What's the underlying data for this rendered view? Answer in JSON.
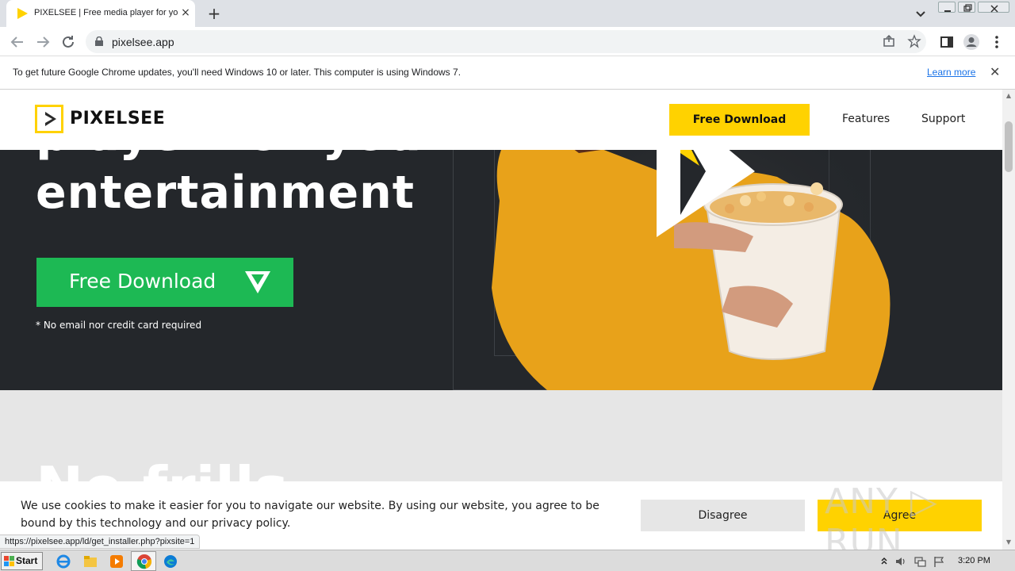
{
  "browser": {
    "tab_title": "PIXELSEE | Free media player for your entertainment",
    "tab_close_icon": "×",
    "new_tab_icon": "+",
    "url": "pixelsee.app",
    "infobar_text": "To get future Google Chrome updates, you'll need Windows 10 or later. This computer is using Windows 7.",
    "infobar_link": "Learn more",
    "infobar_close_icon": "✕",
    "status_url": "https://pixelsee.app/ld/get_installer.php?pixsite=1"
  },
  "site": {
    "logo_text": "PIXELSEE",
    "header_cta": "Free Download",
    "nav": [
      "Features",
      "Support"
    ],
    "hero_line1": "player for your",
    "hero_line2": "entertainment",
    "hero_cta": "Free Download",
    "hero_note": "* No email nor credit card required",
    "section2_title": "No frills",
    "brand_yellow": "#ffd200",
    "cta_green": "#1db954"
  },
  "cookie": {
    "text": "We use cookies to make it easier for you to navigate our website. By using our website, you agree to be bound by this technology and our privacy policy.",
    "disagree": "Disagree",
    "agree": "Agree"
  },
  "watermark": "ANY ▷ RUN",
  "taskbar": {
    "start": "Start",
    "clock": "3:20 PM"
  }
}
